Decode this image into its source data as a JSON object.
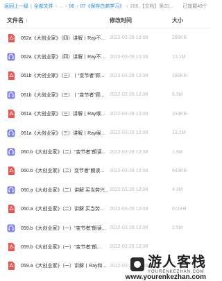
{
  "topbar": {
    "back_label": "返回上一级",
    "all_files_label": "全部文件",
    "crumb_06": "06",
    "crumb_07": "07《保存白商学习》",
    "crumb_206": "206.【文档】第20...",
    "counter": "已加载49个"
  },
  "header": {
    "name_label": "文件名",
    "sort_glyph": "↓",
    "time_label": "修改时间",
    "size_label": "大小"
  },
  "colors": {
    "pdf": "#ef5350",
    "audio": "#7e80e8",
    "link": "#1e88e5"
  },
  "files": [
    {
      "name": "062a《大创业家》（四）讲解丨Ray不喧...",
      "time": "2022-03-28 12:08",
      "size": "289KB",
      "type": "pdf"
    },
    {
      "name": "062a《大创业家》（四）讲解丨Ray不喧...",
      "time": "2022-03-28 12:08",
      "size": "13.1M",
      "type": "audio"
    },
    {
      "name": "061b《大创业家》（三）丨“变节者”顾...",
      "time": "2022-03-28 12:08",
      "size": "180KB",
      "type": "pdf"
    },
    {
      "name": "061b《大创业家》（三）丨“变节者”顾...",
      "time": "2022-03-28 12:08",
      "size": "6.5M",
      "type": "audio"
    },
    {
      "name": "061a《大创业家》（三）讲解丨Ray缑出...",
      "time": "2022-03-28 12:08",
      "size": "314KB",
      "type": "pdf"
    },
    {
      "name": "061a《大创业家》（三）讲解丨Ray缑出...",
      "time": "2022-03-28 12:08",
      "size": "13.2M",
      "type": "audio"
    },
    {
      "name": "060.b《大创业家》（二）“变节者”朗读...",
      "time": "2022-03-28 12:08",
      "size": "1.6M",
      "type": "audio"
    },
    {
      "name": "060.b《大创业家》（二）变节者”朗读...",
      "time": "2022-03-28 12:08",
      "size": "643KB",
      "type": "pdf"
    },
    {
      "name": "060.a《大创业家》（二）讲解 买当劳兴...",
      "time": "2022-03-28 12:08",
      "size": "4.3M",
      "type": "audio"
    },
    {
      "name": "060.a《大创业家》（二）讲解 买当劳...",
      "time": "2022-03-28 12:08",
      "size": "611KB",
      "type": "pdf"
    },
    {
      "name": "059.b《大创业家》（一）“变节者”朗读...",
      "time": "2022-03-28 12:08",
      "size": "2.5M",
      "type": "audio"
    },
    {
      "name": "059.b《大创业家》（一）“变节者”朗...",
      "time": "2022-03-28 12:08",
      "size": "",
      "type": "pdf"
    },
    {
      "name": "059.a《大创业家》（一）讲解丨Ray和...",
      "time": "2022-03-28 12:08",
      "size": "",
      "type": "pdf"
    }
  ],
  "watermark": {
    "cn": "游人客栈",
    "en": "YOURENKEZHAN.COM",
    "url": "www.yourenkezhan.com"
  }
}
